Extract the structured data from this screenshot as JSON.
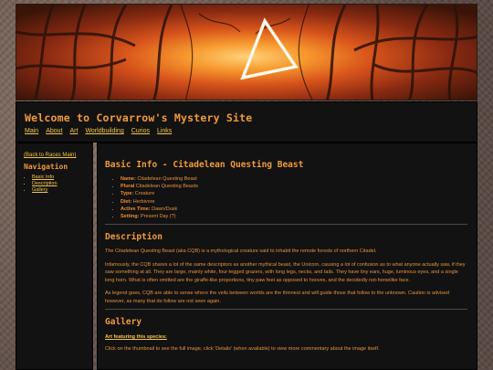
{
  "site": {
    "title": "Welcome to Corvarrow's Mystery Site",
    "nav": [
      "Main",
      "About",
      "Art",
      "Worldbuilding",
      "Curios",
      "Links"
    ]
  },
  "sidebar": {
    "back_link": "(Back to Races Main)",
    "heading": "Navigation",
    "items": [
      "Basic Info",
      "Description",
      "Gallery"
    ]
  },
  "main": {
    "basic_heading": "Basic Info - Citadelean Questing Beast",
    "info": [
      {
        "label": "Name:",
        "value": "Citadelean Questing Beast"
      },
      {
        "label": "Plural",
        "value": "Citadelean Questing Beasts"
      },
      {
        "label": "Type:",
        "value": "Creature"
      },
      {
        "label": "Diet:",
        "value": "Herbivore"
      },
      {
        "label": "Active Time:",
        "value": "Dawn/Dusk"
      },
      {
        "label": "Setting:",
        "value": "Present Day (?)"
      }
    ],
    "description_heading": "Description",
    "paragraphs": [
      "The Citadelean Questing Beast (aka CQB) is a mythological creature said to inhabit the remote forests of northern Citadel.",
      "Infamously, the CQB shares a lot of the same descriptors as another mythical beast, the Unicorn, causing a lot of confusion as to what anyone actually saw, if they saw something at all. They are large, mainly white, four-legged grazers, with long legs, necks, and tails. They have tiny ears, huge, luminous eyes, and a single long horn. What is often omitted are the giraffe-like proportions, tiny paw feet as opposed to hooves, and the decidedly not-horselike face.",
      "As legend goes, CQB are able to sense where the veils between worlds are the thinnest and will guide those that follow to the unknown. Caution is advised however, as many that do follow are not seen again."
    ],
    "gallery_heading": "Gallery",
    "gallery_sub": "Art featuring this species:",
    "gallery_note": "Click on the thumbnail to see the full image, click 'Details' (when available) to view more commentary about the image itself."
  }
}
